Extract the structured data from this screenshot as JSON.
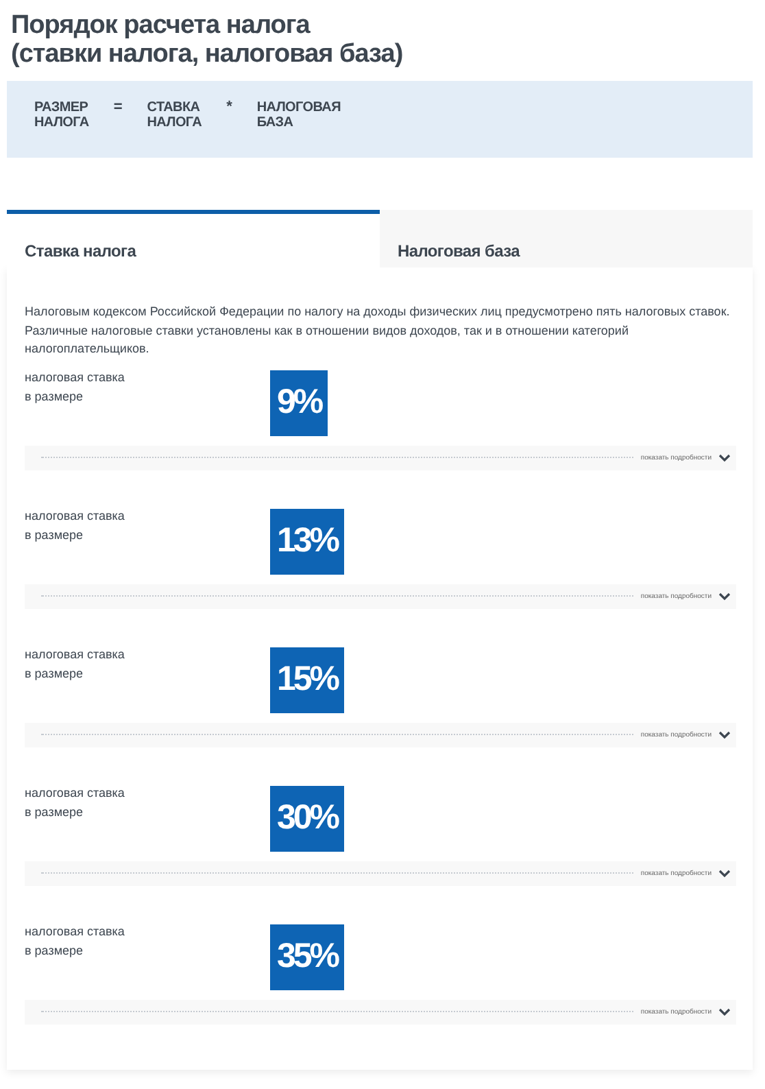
{
  "title": [
    "Порядок расчета налога",
    "(ставки налога, налоговая база)"
  ],
  "formula": [
    {
      "kind": "term",
      "lines": [
        "РАЗМЕР",
        "НАЛОГА"
      ]
    },
    {
      "kind": "operator",
      "lines": [
        "="
      ]
    },
    {
      "kind": "term",
      "lines": [
        "СТАВКА",
        "НАЛОГА"
      ]
    },
    {
      "kind": "operator",
      "lines": [
        "*"
      ]
    },
    {
      "kind": "term",
      "lines": [
        "НАЛОГОВАЯ",
        "БАЗА"
      ]
    }
  ],
  "tabs": [
    {
      "label": "Ставка налога",
      "selected": true
    },
    {
      "label": "Налоговая база",
      "selected": false
    }
  ],
  "intro": "Налоговым кодексом Российской Федерации по налогу на доходы физических лиц предусмотрено пять налоговых ставок. Различные налоговые ставки установлены как в отношении видов доходов, так и в отношении категорий налогоплательщиков.",
  "rates": [
    {
      "label": [
        "налоговая ставка",
        "в размере"
      ],
      "value": "9%",
      "details": "показать подробности"
    },
    {
      "label": [
        "налоговая ставка",
        "в размере"
      ],
      "value": "13%",
      "details": "показать подробности"
    },
    {
      "label": [
        "налоговая ставка",
        "в размере"
      ],
      "value": "15%",
      "details": "показать подробности"
    },
    {
      "label": [
        "налоговая ставка",
        "в размере"
      ],
      "value": "30%",
      "details": "показать подробности"
    },
    {
      "label": [
        "налоговая ставка",
        "в размере"
      ],
      "value": "35%",
      "details": "показать подробности"
    }
  ]
}
